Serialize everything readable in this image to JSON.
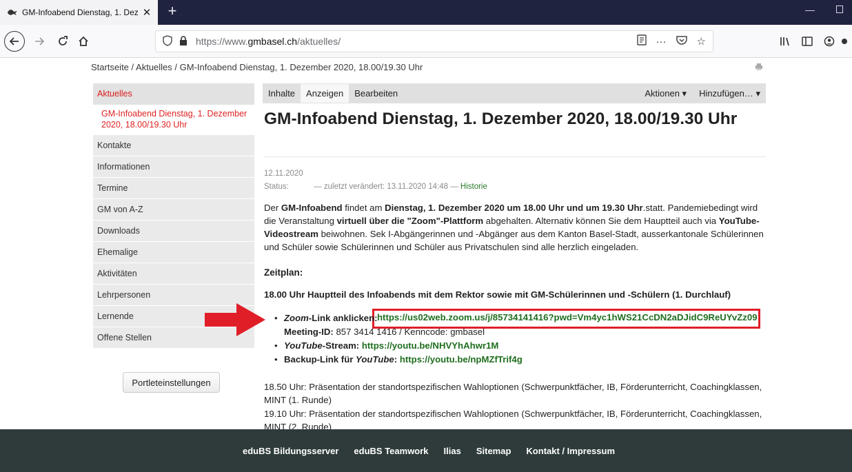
{
  "browser": {
    "tab_title": "GM-Infoabend Dienstag, 1. Dez",
    "url_prefix": "https://www.",
    "url_domain": "gmbasel.ch",
    "url_path": "/aktuelles/",
    "url_icons": [
      "reader-icon",
      "more-icon",
      "pocket-icon",
      "bookmark-star-icon"
    ],
    "toolbar_icons": [
      "library-icon",
      "sidebar-icon",
      "account-icon"
    ]
  },
  "page": {
    "breadcrumb": "Startseite / Aktuelles / GM-Infoabend Dienstag, 1. Dezember 2020, 18.00/19.30 Uhr",
    "sidebar": {
      "header": "Aktuelles",
      "sub_item": "GM-Infoabend Dienstag, 1. Dezember 2020, 18.00/19.30 Uhr",
      "items": [
        "Kontakte",
        "Informationen",
        "Termine",
        "GM von A-Z",
        "Downloads",
        "Ehemalige",
        "Aktivitäten",
        "Lehrpersonen",
        "Lernende",
        "Offene Stellen"
      ],
      "portlet_button": "Portleteinstellungen"
    },
    "toolbar": {
      "tabs": [
        "Inhalte",
        "Anzeigen",
        "Bearbeiten"
      ],
      "actions": "Aktionen ▾",
      "add": "Hinzufügen… ▾"
    },
    "title": "GM-Infoabend Dienstag, 1. Dezember 2020, 18.00/19.30 Uhr",
    "date": "12.11.2020",
    "status_label": "Status:",
    "status_text": "— zuletzt verändert: 13.11.2020 14:48 —",
    "history_link": "Historie",
    "intro": {
      "p1": "Der ",
      "b1": "GM-Infoabend",
      "p2": " findet am ",
      "b2": "Dienstag, 1. Dezember 2020 um 18.00 Uhr und um 19.30 Uhr",
      "p3": ".statt. Pandemiebedingt wird die Veranstaltung ",
      "b3": "virtuell über die \"Zoom\"-Plattform",
      "p4": " abgehalten. Alternativ können Sie dem Hauptteil auch via ",
      "b4": "YouTube-Videostream",
      "p5": " beiwohnen. Sek I-Abgängerinnen und -Abgänger aus dem Kanton Basel-Stadt, ausserkantonale Schülerinnen und Schüler sowie Schülerinnen und Schüler aus Privatschulen sind alle herzlich eingeladen."
    },
    "zeitplan": "Zeitplan:",
    "main_heading": "18.00 Uhr Hauptteil des Infoabends mit dem Rektor sowie mit GM-Schülerinnen und -Schülern (1. Durchlauf)",
    "bullets": {
      "zoom_label_em": "Zoom",
      "zoom_label": "-Link anklicken:",
      "zoom_url": "https://us02web.zoom.us/j/85734141416?pwd=Vm4yc1hWS21CcDN2aDJidC9ReUYvZz09",
      "meeting_label": "Meeting-ID:",
      "meeting_value": "857 3414 1416  /  Kenncode: gmbasel",
      "youtube_em": "YouTube",
      "youtube_label": "-Stream:",
      "youtube_url": "https://youtu.be/NHVYhAhwr1M",
      "backup_label": "Backup-Link für ",
      "backup_em": "YouTube",
      "backup_colon": ":",
      "backup_url": "https://youtu.be/npMZfTrif4g"
    },
    "schedule": [
      "18.50 Uhr: Präsentation der standortspezifischen Wahloptionen (Schwerpunktfächer, IB, Förderunterricht, Coachingklassen, MINT (1. Runde)",
      "19.10 Uhr: Präsentation der standortspezifischen Wahloptionen (Schwerpunktfächer, IB, Förderunterricht, Coachingklassen, MINT (2. Runde)"
    ],
    "footer": [
      "eduBS Bildungsserver",
      "eduBS Teamwork",
      "Ilias",
      "Sitemap",
      "Kontakt / Impressum"
    ]
  },
  "colors": {
    "tabbar": "#202340",
    "sidebar_active": "#d91c1c",
    "link_green": "#1f6e1f",
    "highlight_red": "#e01e28",
    "footer_bg": "#2f3b3b"
  }
}
